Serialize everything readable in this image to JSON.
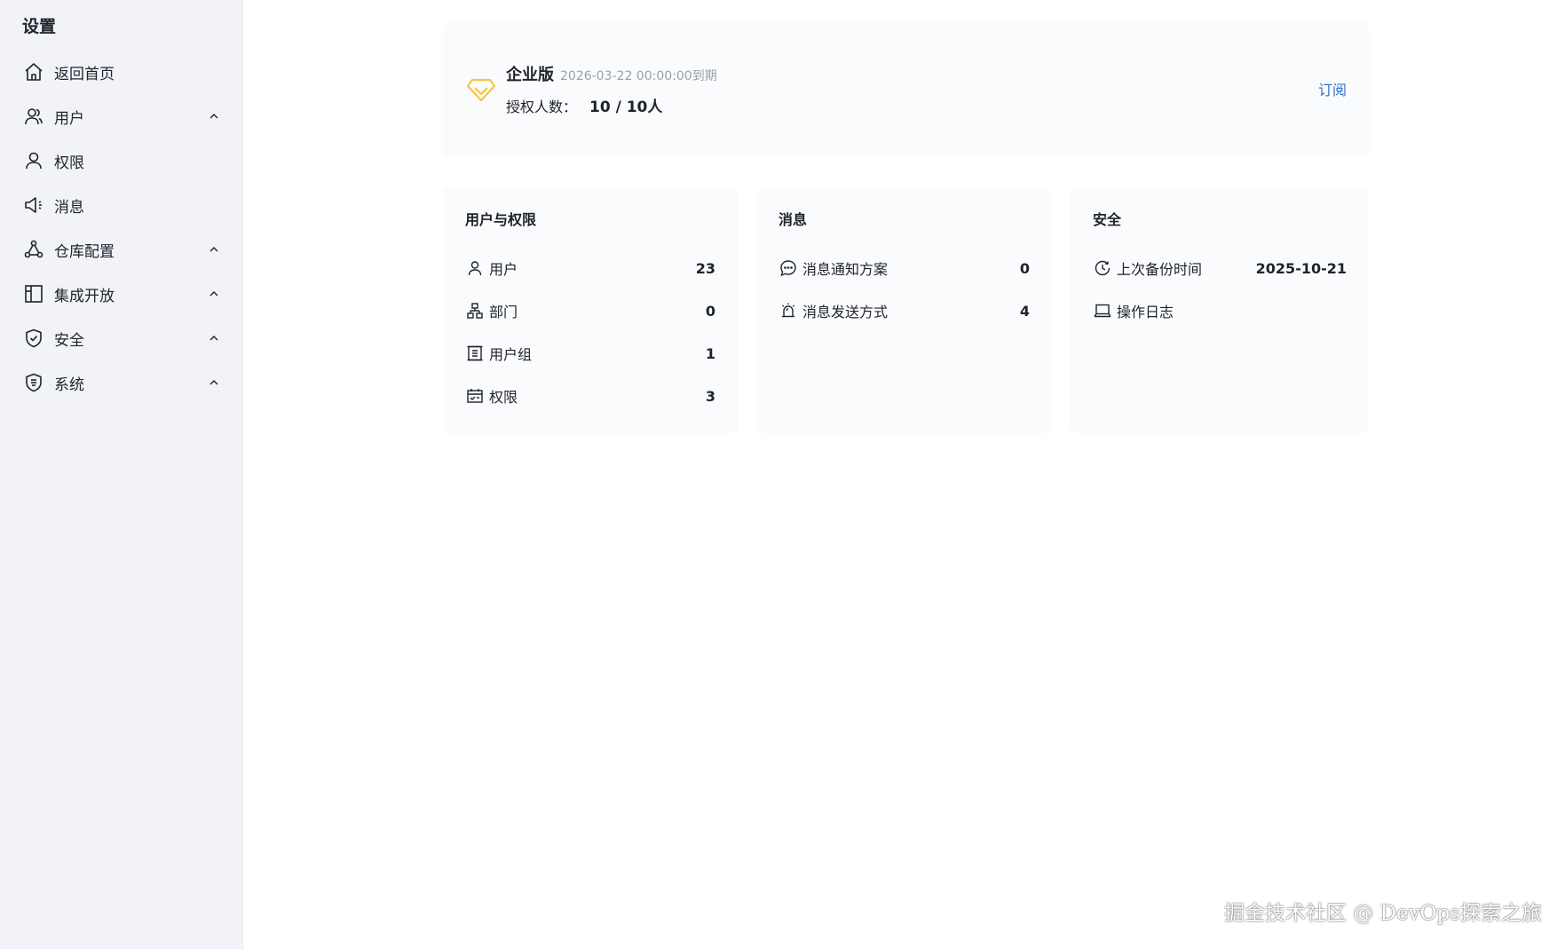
{
  "sidebar": {
    "title": "设置",
    "items": [
      {
        "label": "返回首页",
        "icon": "home-icon",
        "expandable": false
      },
      {
        "label": "用户",
        "icon": "users-icon",
        "expandable": true
      },
      {
        "label": "权限",
        "icon": "user-icon",
        "expandable": false
      },
      {
        "label": "消息",
        "icon": "megaphone-icon",
        "expandable": false
      },
      {
        "label": "仓库配置",
        "icon": "nodes-icon",
        "expandable": true
      },
      {
        "label": "集成开放",
        "icon": "layout-icon",
        "expandable": true
      },
      {
        "label": "安全",
        "icon": "shield-check-icon",
        "expandable": true
      },
      {
        "label": "系统",
        "icon": "shield-badge-icon",
        "expandable": true
      }
    ]
  },
  "license": {
    "edition": "企业版",
    "expire": "2026-03-22 00:00:00到期",
    "seats_label": "授权人数：",
    "seats_value": "10 / 10人",
    "subscribe_label": "订阅",
    "icon": "diamond-icon",
    "icon_color": "#f5c542"
  },
  "cards": [
    {
      "title": "用户与权限",
      "rows": [
        {
          "icon": "user-icon",
          "label": "用户",
          "value": "23"
        },
        {
          "icon": "org-chart-icon",
          "label": "部门",
          "value": "0"
        },
        {
          "icon": "group-icon",
          "label": "用户组",
          "value": "1"
        },
        {
          "icon": "calendar-check-icon",
          "label": "权限",
          "value": "3"
        }
      ]
    },
    {
      "title": "消息",
      "rows": [
        {
          "icon": "chat-bubble-icon",
          "label": "消息通知方案",
          "value": "0"
        },
        {
          "icon": "alarm-icon",
          "label": "消息发送方式",
          "value": "4"
        }
      ]
    },
    {
      "title": "安全",
      "rows": [
        {
          "icon": "clock-icon",
          "label": "上次备份时间",
          "value": "2025-10-21"
        },
        {
          "icon": "laptop-icon",
          "label": "操作日志",
          "value": ""
        }
      ]
    }
  ],
  "watermark": "掘金技术社区 @ DevOps探索之旅",
  "colors": {
    "sidebar_bg": "#f1f3f9",
    "card_bg": "#fafbfd",
    "link": "#2f6fc4",
    "text": "#1f2329",
    "muted": "#9aa0aa"
  }
}
